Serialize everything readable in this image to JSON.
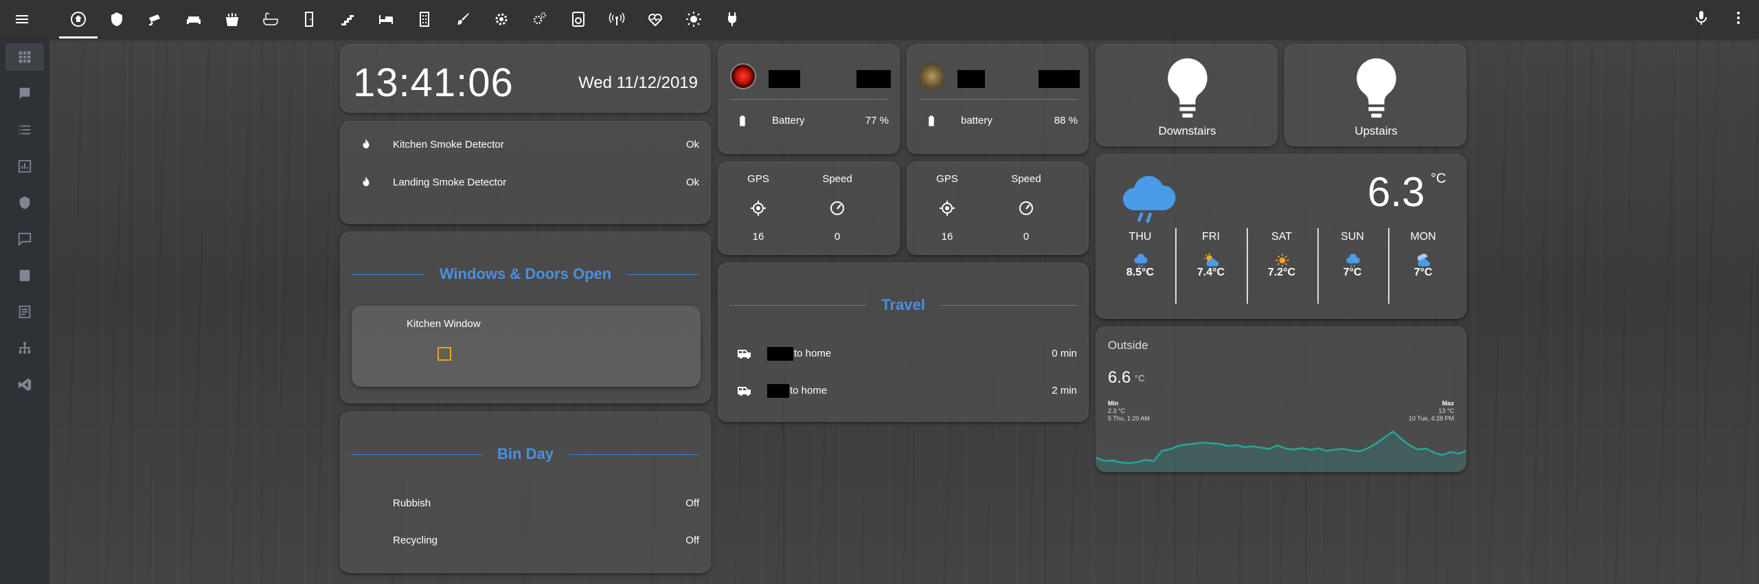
{
  "header": {
    "menu_icon": "menu-icon",
    "tabs": [
      "home-icon",
      "shield-home-icon",
      "cctv-icon",
      "sofa-icon",
      "stove-icon",
      "bathtub-icon",
      "door-icon",
      "stairs-icon",
      "bed-icon",
      "office-building-icon",
      "brush-icon",
      "settings-icon",
      "settings-cogs-icon",
      "washing-machine-icon",
      "router-wireless-icon",
      "heart-pulse-icon",
      "weather-sunny-icon",
      "power-plug-icon"
    ],
    "right_icons": [
      "microphone-icon",
      "more-vert-icon"
    ]
  },
  "sidebar": {
    "items": [
      "overview-icon",
      "logbook-icon",
      "list-icon",
      "history-icon",
      "shield-icon",
      "chat-icon",
      "currency-icon",
      "notes-icon",
      "sitemap-icon",
      "code-icon"
    ]
  },
  "clock_card": {
    "time": "13:41:06",
    "date": "Wed 11/12/2019"
  },
  "smoke_card": {
    "rows": [
      {
        "label": "Kitchen Smoke Detector",
        "state": "Ok"
      },
      {
        "label": "Landing Smoke Detector",
        "state": "Ok"
      }
    ]
  },
  "windows_card": {
    "title": "Windows & Doors Open",
    "item_label": "Kitchen Window"
  },
  "bin_card": {
    "title": "Bin Day",
    "rows": [
      {
        "label": "Rubbish",
        "state": "Off"
      },
      {
        "label": "Recycling",
        "state": "Off"
      }
    ]
  },
  "person1": {
    "battery_label": "Battery",
    "battery_value": "77 %",
    "gps_label": "GPS",
    "speed_label": "Speed",
    "gps_value": "16",
    "speed_value": "0"
  },
  "person2": {
    "battery_label": "battery",
    "battery_value": "88 %",
    "gps_label": "GPS",
    "speed_label": "Speed",
    "gps_value": "16",
    "speed_value": "0"
  },
  "travel_card": {
    "title": "Travel",
    "rows": [
      {
        "label": "to home",
        "value": "0 min"
      },
      {
        "label": "to home",
        "value": "2 min"
      }
    ]
  },
  "lights": [
    {
      "label": "Downstairs"
    },
    {
      "label": "Upstairs"
    }
  ],
  "weather": {
    "temperature": "6.3",
    "unit": "°C",
    "forecast": [
      {
        "day": "THU",
        "temp": "8.5°C",
        "icon": "rain-icon"
      },
      {
        "day": "FRI",
        "temp": "7.4°C",
        "icon": "partly-sunny-icon"
      },
      {
        "day": "SAT",
        "temp": "7.2°C",
        "icon": "sun-icon"
      },
      {
        "day": "SUN",
        "temp": "7°C",
        "icon": "rain-icon"
      },
      {
        "day": "MON",
        "temp": "7°C",
        "icon": "cloudy-icon"
      }
    ]
  },
  "outside": {
    "title": "Outside",
    "value": "6.6",
    "unit": "°C",
    "min_label": "Min",
    "min_value": "2.3 °C",
    "min_time": "5 Thu, 1:20 AM",
    "max_label": "Max",
    "max_value": "13 °C",
    "max_time": "10 Tue, 4:28 PM"
  },
  "chart_data": {
    "type": "area",
    "title": "",
    "series": [
      {
        "values": [
          4.1,
          3.0,
          3.2,
          2.5,
          2.3,
          2.6,
          3.4,
          3.0,
          6.5,
          7.0,
          8.2,
          8.6,
          8.9,
          9.2,
          9.0,
          8.8,
          8.1,
          8.4,
          7.7,
          8.0,
          7.5,
          7.1,
          8.3,
          7.2,
          6.9,
          7.4,
          6.8,
          7.3,
          6.4,
          6.9,
          7.1,
          6.5,
          6.3,
          7.4,
          9.0,
          11.0,
          13.0,
          10.5,
          8.4,
          6.9,
          7.2,
          5.8,
          5.0,
          6.1,
          5.5,
          6.6
        ]
      }
    ]
  }
}
